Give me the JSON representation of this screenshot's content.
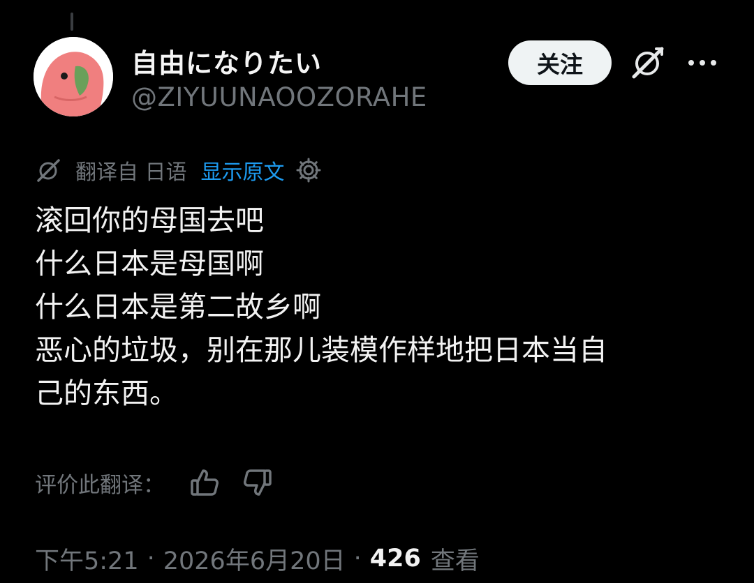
{
  "user": {
    "display_name": "自由になりたい",
    "handle": "@ZIYUUNAOOZORAHE"
  },
  "header": {
    "follow_label": "关注",
    "more_label": "···"
  },
  "translation": {
    "from_label": "翻译自 日语",
    "show_original_label": "显示原文"
  },
  "tweet": {
    "lines": [
      "滚回你的母国去吧",
      "什么日本是母国啊",
      "什么日本是第二故乡啊",
      "恶心的垃圾，别在那儿装模作样地把日本当自",
      "己的东西。"
    ]
  },
  "rating": {
    "label": "评价此翻译："
  },
  "meta": {
    "time": "下午5:21",
    "separator": "·",
    "date": "2026年6月20日",
    "views_count": "426",
    "views_label": "查看"
  },
  "icons": {
    "grok": "grok-icon",
    "gear": "gear-icon",
    "thumbs_up": "thumbs-up-icon",
    "thumbs_down": "thumbs-down-icon",
    "more": "more-icon"
  },
  "colors": {
    "background": "#000000",
    "text": "#f2f2f2",
    "muted": "#71767b",
    "link": "#1d9bf0",
    "follow_button": "#eff3f4",
    "avatar_parrot": "#f07f7f"
  }
}
